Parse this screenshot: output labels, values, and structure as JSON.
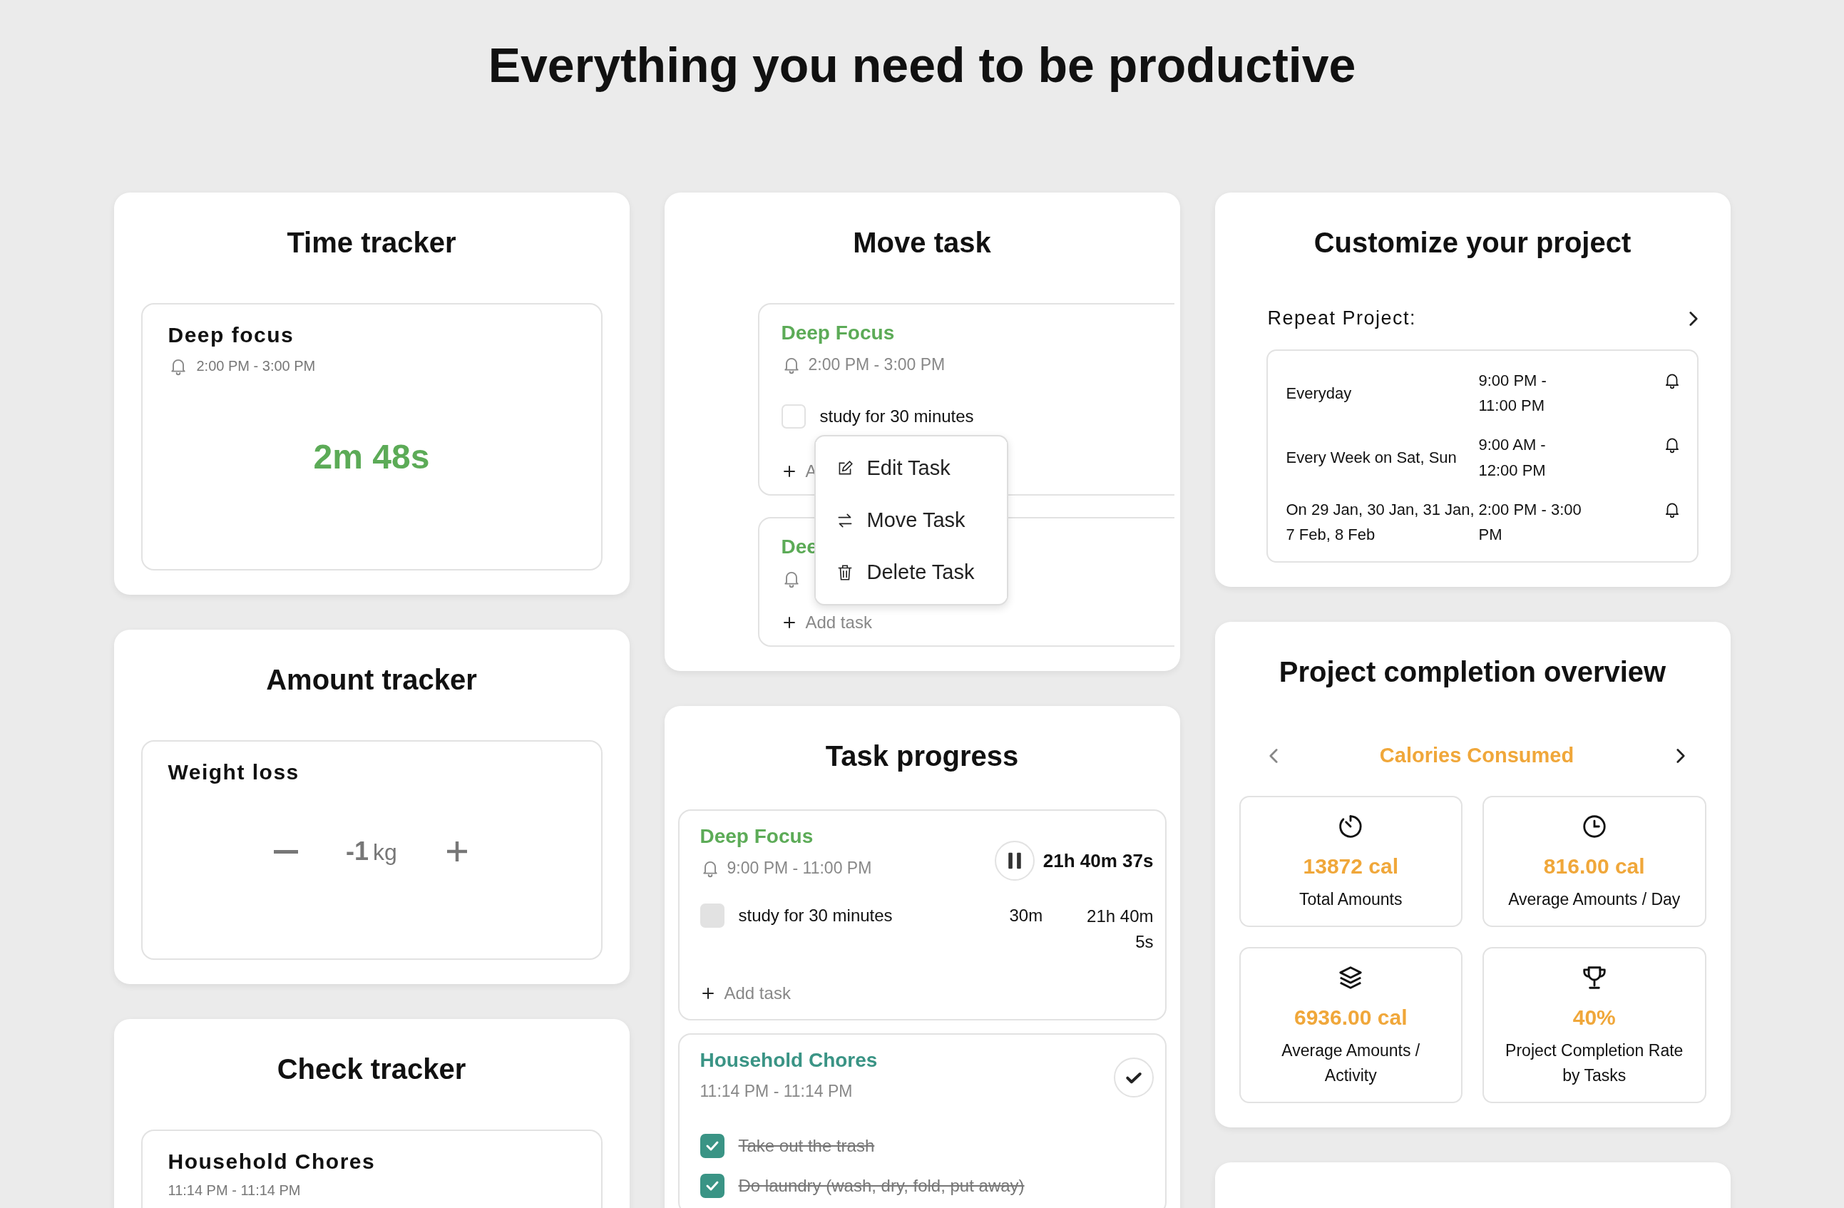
{
  "heading": "Everything you need to be productive",
  "time_tracker": {
    "title": "Time tracker",
    "task": {
      "name": "Deep focus",
      "time": "2:00 PM - 3:00 PM",
      "elapsed": "2m 48s"
    }
  },
  "amount_tracker": {
    "title": "Amount tracker",
    "item": {
      "name": "Weight loss",
      "value": "-1",
      "unit": "kg"
    }
  },
  "check_tracker": {
    "title": "Check tracker",
    "task": {
      "name": "Household Chores",
      "time": "11:14 PM - 11:14 PM"
    }
  },
  "move_task": {
    "title": "Move task",
    "tasks": [
      {
        "name": "Deep Focus",
        "time": "2:00 PM - 3:00 PM",
        "subtasks": [
          {
            "label": "study for 30 minutes",
            "checked": false
          }
        ],
        "add_label": "A"
      },
      {
        "name": "Dee",
        "add_label": "Add task"
      }
    ],
    "menu": [
      {
        "kind": "edit",
        "label": "Edit Task"
      },
      {
        "kind": "move",
        "label": "Move Task"
      },
      {
        "kind": "delete",
        "label": "Delete Task"
      }
    ]
  },
  "task_progress": {
    "title": "Task progress",
    "tasks": [
      {
        "name": "Deep Focus",
        "color": "#5cab57",
        "kind": "timed",
        "time": "9:00 PM - 11:00 PM",
        "timer": "21h 40m 37s",
        "subtasks": [
          {
            "label": "study for 30 minutes",
            "checked": false,
            "duration": "30m",
            "spent": "21h 40m 5s"
          }
        ],
        "add_label": "Add task"
      },
      {
        "name": "Household Chores",
        "color": "#3a9485",
        "kind": "checklist",
        "time": "11:14 PM - 11:14 PM",
        "subtasks": [
          {
            "label": "Take out the trash",
            "checked": true
          },
          {
            "label": "Do laundry (wash, dry, fold, put away)",
            "checked": true
          }
        ]
      }
    ]
  },
  "customize": {
    "title": "Customize your project",
    "repeat_label": "Repeat Project:",
    "schedules": [
      {
        "days": "Everyday",
        "time": "9:00 PM - 11:00 PM"
      },
      {
        "days": "Every Week on Sat, Sun",
        "time": "9:00 AM - 12:00 PM"
      },
      {
        "days": "On 29 Jan, 30 Jan, 31 Jan, 7 Feb, 8 Feb",
        "time": "2:00 PM - 3:00 PM"
      }
    ]
  },
  "overview": {
    "title": "Project completion overview",
    "metric": "Calories Consumed",
    "stats": [
      {
        "kind": "timer",
        "value": "13872 cal",
        "label": "Total Amounts"
      },
      {
        "kind": "clock",
        "value": "816.00 cal",
        "label": "Average Amounts / Day"
      },
      {
        "kind": "layers",
        "value": "6936.00 cal",
        "label": "Average Amounts / Activity"
      },
      {
        "kind": "trophy",
        "value": "40%",
        "label": "Project Completion Rate by Tasks"
      }
    ]
  }
}
